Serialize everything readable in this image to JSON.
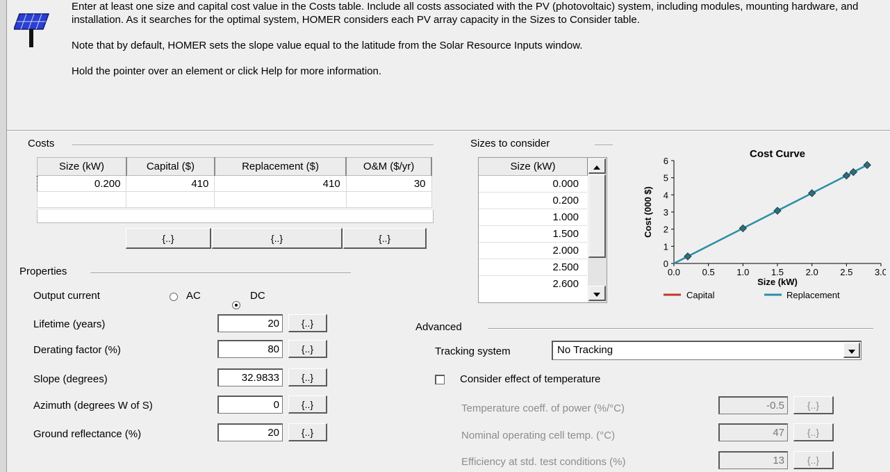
{
  "info": {
    "para1": "Enter at least one size and capital cost value in the Costs table.  Include all costs associated with the PV (photovoltaic) system, including modules, mounting hardware, and installation. As it searches for the optimal system, HOMER considers each PV array capacity in the Sizes to Consider table.",
    "para2": "Note that by default, HOMER sets the slope value equal to the latitude from the Solar Resource Inputs window.",
    "para3": "Hold the pointer over an element or click Help for more information."
  },
  "costs": {
    "group_label": "Costs",
    "headers": [
      "Size (kW)",
      "Capital ($)",
      "Replacement ($)",
      "O&M ($/yr)"
    ],
    "rows": [
      [
        "0.200",
        "410",
        "410",
        "30"
      ],
      [
        "",
        "",
        "",
        ""
      ]
    ],
    "sens_label": "{..}"
  },
  "sizes": {
    "group_label": "Sizes to consider",
    "header": "Size (kW)",
    "values": [
      "0.000",
      "0.200",
      "1.000",
      "1.500",
      "2.000",
      "2.500",
      "2.600"
    ]
  },
  "chart_data": {
    "type": "line",
    "title": "Cost Curve",
    "xlabel": "Size (kW)",
    "ylabel": "Cost (000 $)",
    "xlim": [
      0,
      3
    ],
    "ylim": [
      0,
      6
    ],
    "xticks": [
      "0.0",
      "0.5",
      "1.0",
      "1.5",
      "2.0",
      "2.5",
      "3.0"
    ],
    "yticks": [
      "0",
      "1",
      "2",
      "3",
      "4",
      "5",
      "6"
    ],
    "series": [
      {
        "name": "Capital",
        "color": "#c0392b",
        "x": [
          0,
          0.2,
          1.0,
          1.5,
          2.0,
          2.5,
          2.6,
          2.8
        ],
        "y": [
          0,
          0.41,
          2.05,
          3.075,
          4.1,
          5.125,
          5.33,
          5.74
        ]
      },
      {
        "name": "Replacement",
        "color": "#2a8fa8",
        "x": [
          0,
          0.2,
          1.0,
          1.5,
          2.0,
          2.5,
          2.6,
          2.8
        ],
        "y": [
          0,
          0.41,
          2.05,
          3.075,
          4.1,
          5.125,
          5.33,
          5.74
        ]
      }
    ],
    "markers_x": [
      0.2,
      1.0,
      1.5,
      2.0,
      2.5,
      2.6,
      2.8
    ],
    "grid": false,
    "legend": "bottom"
  },
  "properties": {
    "group_label": "Properties",
    "output_current_label": "Output current",
    "ac_label": "AC",
    "dc_label": "DC",
    "selected": "DC",
    "fields": [
      {
        "label": "Lifetime (years)",
        "value": "20"
      },
      {
        "label": "Derating factor (%)",
        "value": "80"
      },
      {
        "label": "Slope (degrees)",
        "value": "32.9833"
      },
      {
        "label": "Azimuth (degrees W of S)",
        "value": "0"
      },
      {
        "label": "Ground reflectance (%)",
        "value": "20"
      }
    ],
    "sens_label": "{..}"
  },
  "advanced": {
    "group_label": "Advanced",
    "tracking_label": "Tracking system",
    "tracking_value": "No Tracking",
    "temp_check_label": "Consider effect of temperature",
    "temp_checked": false,
    "temp_fields": [
      {
        "label": "Temperature coeff. of power (%/°C)",
        "value": "-0.5"
      },
      {
        "label": "Nominal operating cell temp. (°C)",
        "value": "47"
      },
      {
        "label": "Efficiency at std. test conditions (%)",
        "value": "13"
      }
    ],
    "sens_label": "{..}"
  }
}
